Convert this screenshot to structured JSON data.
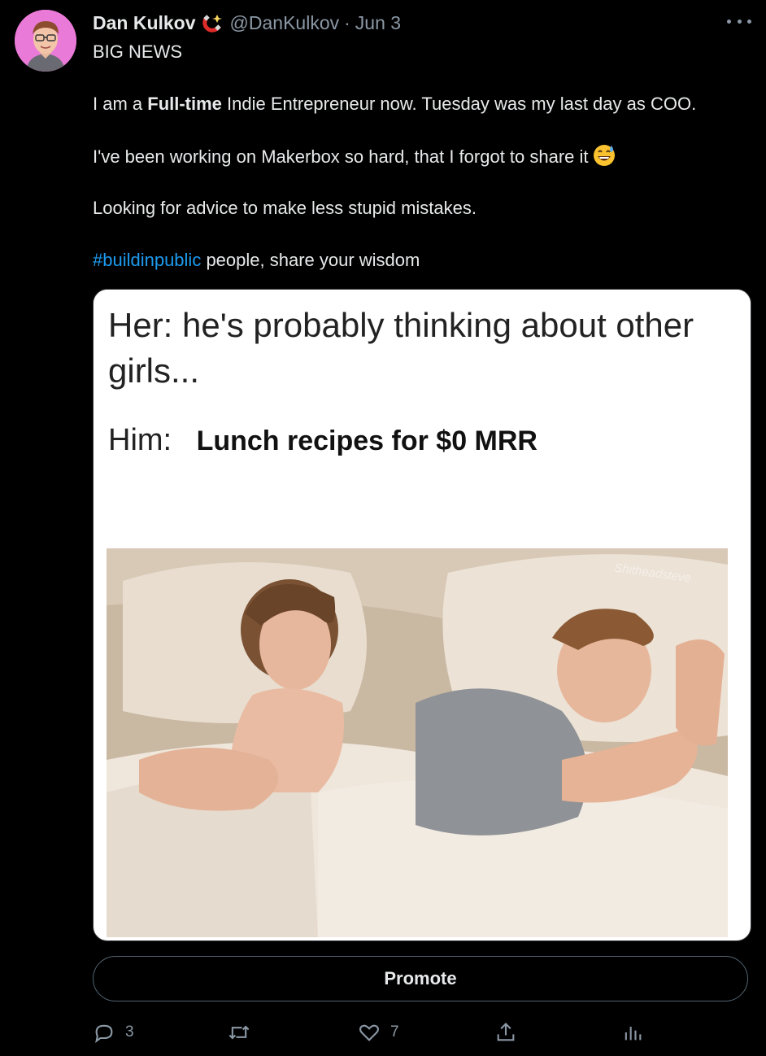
{
  "author": {
    "name": "Dan Kulkov",
    "handle": "@DanKulkov",
    "separator": "·",
    "date": "Jun 3",
    "badge_icon": "magnet-icon",
    "avatar_bg": "#ea7ad8"
  },
  "tweet": {
    "line1": "BIG NEWS",
    "line2_pre": "I am a ",
    "line2_bold": "Full-time",
    "line2_post": " Indie Entrepreneur now. Tuesday was my last day as COO.",
    "line3": "I've been working on Makerbox so hard, that I forgot to share it",
    "line3_emoji": "grinning-sweat-emoji",
    "line4": "Looking for advice to make less stupid mistakes.",
    "hashtag": "#buildinpublic",
    "line5_post": " people, share your wisdom"
  },
  "meme": {
    "her_text": "Her: he's probably thinking about other girls...",
    "him_label": "Him:",
    "him_text": "Lunch recipes for $0 MRR",
    "watermark": "Shitheadsteve"
  },
  "promote_label": "Promote",
  "actions": {
    "reply_count": "3",
    "retweet_count": "",
    "like_count": "7",
    "share_count": "",
    "analytics_count": ""
  },
  "colors": {
    "background": "#000000",
    "text": "#e7e9ea",
    "muted": "#8b98a5",
    "link": "#1d9bf0"
  }
}
